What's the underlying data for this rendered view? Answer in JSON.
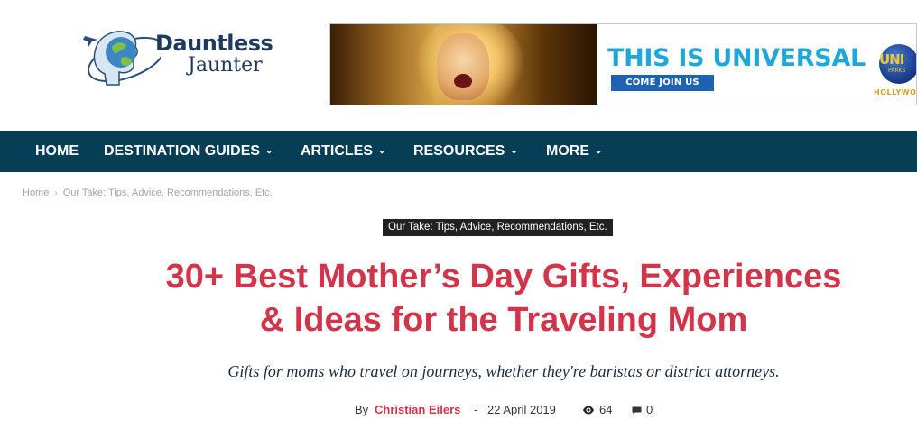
{
  "header": {
    "logo": {
      "line1": "Dauntless",
      "line2": "Jaunter"
    },
    "ad": {
      "headline": "THIS IS UNIVERSAL",
      "cta": "COME JOIN US",
      "brand_short": "UNI",
      "brand_sub": "PARKS",
      "brand_location": "HOLLYWOO",
      "colors": {
        "headline": "#1fa8d7",
        "cta_bg": "#1d63b4",
        "brand": "#e9c63a"
      }
    }
  },
  "nav": {
    "items": [
      {
        "label": "HOME",
        "has_dropdown": false
      },
      {
        "label": "DESTINATION GUIDES",
        "has_dropdown": true
      },
      {
        "label": "ARTICLES",
        "has_dropdown": true
      },
      {
        "label": "RESOURCES",
        "has_dropdown": true
      },
      {
        "label": "MORE",
        "has_dropdown": true
      }
    ],
    "background": "#063e55"
  },
  "breadcrumb": {
    "items": [
      "Home",
      "Our Take: Tips, Advice, Recommendations, Etc."
    ],
    "separator": "›"
  },
  "article": {
    "category": "Our Take: Tips, Advice, Recommendations, Etc.",
    "title_line1": "30+ Best Mother’s Day Gifts, Experiences",
    "title_line2": "& Ideas for the Traveling Mom",
    "subtitle": "Gifts for moms who travel on journeys, whether they're baristas or district attorneys.",
    "meta": {
      "by": "By",
      "author": "Christian Eilers",
      "dash": "-",
      "date": "22 April 2019",
      "views": "64",
      "comments": "0"
    },
    "colors": {
      "title": "#d2354a",
      "author": "#d2354a"
    }
  }
}
